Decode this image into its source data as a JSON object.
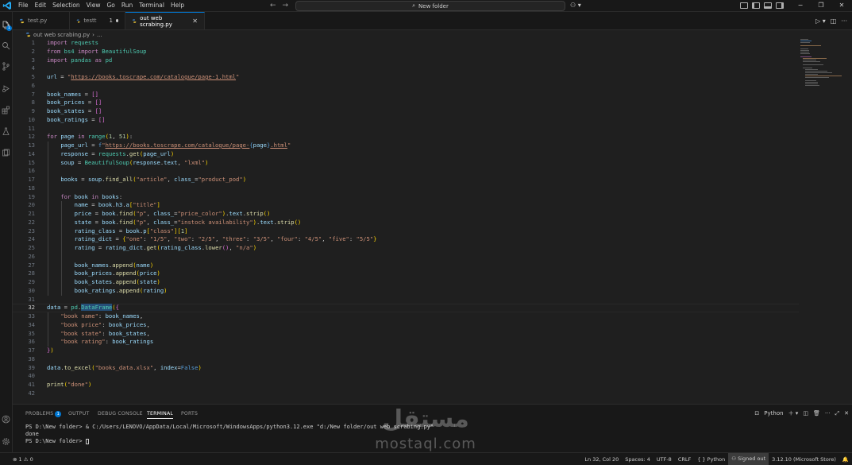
{
  "menu": [
    "File",
    "Edit",
    "Selection",
    "View",
    "Go",
    "Run",
    "Terminal",
    "Help"
  ],
  "search": {
    "label": "New folder"
  },
  "window_controls": {
    "minimize": "−",
    "restore": "❐",
    "close": "✕"
  },
  "tabs": [
    {
      "label": "test.py",
      "modified": "",
      "active": false
    },
    {
      "label": "testt",
      "modified": "1",
      "active": false
    },
    {
      "label": "out web scrabing.py",
      "modified": "",
      "active": true
    }
  ],
  "breadcrumb": {
    "file": "out web scrabing.py",
    "rest": "..."
  },
  "code_lines": [
    {
      "n": "1",
      "html": "<span class=\"k\">import</span> <span class=\"t\">requests</span>"
    },
    {
      "n": "2",
      "html": "<span class=\"k\">from</span> <span class=\"t\">bs4</span> <span class=\"k\">import</span> <span class=\"t\">BeautifulSoup</span>"
    },
    {
      "n": "3",
      "html": "<span class=\"k\">import</span> <span class=\"t\">pandas</span> <span class=\"k\">as</span> <span class=\"t\">pd</span>"
    },
    {
      "n": "4",
      "html": ""
    },
    {
      "n": "5",
      "html": "<span class=\"v\">url</span> = <span class=\"s\">\"<span class=\"u\">https://books.toscrape.com/catalogue/page-1.html</span>\"</span>"
    },
    {
      "n": "6",
      "html": ""
    },
    {
      "n": "7",
      "html": "<span class=\"v\">book_names</span> = <span class=\"p2\">[]</span>"
    },
    {
      "n": "8",
      "html": "<span class=\"v\">book_prices</span> = <span class=\"p2\">[]</span>"
    },
    {
      "n": "9",
      "html": "<span class=\"v\">book_states</span> = <span class=\"p2\">[]</span>"
    },
    {
      "n": "10",
      "html": "<span class=\"v\">book_ratings</span> = <span class=\"p2\">[]</span>"
    },
    {
      "n": "11",
      "html": ""
    },
    {
      "n": "12",
      "html": "<span class=\"k\">for</span> <span class=\"v\">page</span> <span class=\"k\">in</span> <span class=\"t\">range</span><span class=\"p\">(</span><span class=\"n\">1</span>, <span class=\"n\">51</span><span class=\"p\">)</span>:"
    },
    {
      "n": "13",
      "html": "    <span class=\"v\">page_url</span> = <span class=\"b\">f</span><span class=\"s\">\"<span class=\"u\">https://books.toscrape.com/catalogue/page-</span></span><span class=\"b\">{</span><span class=\"v\">page</span><span class=\"b\">}</span><span class=\"s\"><span class=\"u\">.html</span>\"</span>"
    },
    {
      "n": "14",
      "html": "    <span class=\"v\">response</span> = <span class=\"t\">requests</span>.<span class=\"f\">get</span><span class=\"p\">(</span><span class=\"v\">page_url</span><span class=\"p\">)</span>"
    },
    {
      "n": "15",
      "html": "    <span class=\"v\">soup</span> = <span class=\"t\">BeautifulSoup</span><span class=\"p\">(</span><span class=\"v\">response</span>.<span class=\"v\">text</span>, <span class=\"s\">\"lxml\"</span><span class=\"p\">)</span>"
    },
    {
      "n": "16",
      "html": ""
    },
    {
      "n": "17",
      "html": "    <span class=\"v\">books</span> = <span class=\"v\">soup</span>.<span class=\"f\">find_all</span><span class=\"p\">(</span><span class=\"s\">\"article\"</span>, <span class=\"v\">class_</span>=<span class=\"s\">\"product_pod\"</span><span class=\"p\">)</span>"
    },
    {
      "n": "18",
      "html": ""
    },
    {
      "n": "19",
      "html": "    <span class=\"k\">for</span> <span class=\"v\">book</span> <span class=\"k\">in</span> <span class=\"v\">books</span>:"
    },
    {
      "n": "20",
      "html": "        <span class=\"v\">name</span> = <span class=\"v\">book</span>.<span class=\"v\">h3</span>.<span class=\"v\">a</span><span class=\"p\">[</span><span class=\"s\">\"title\"</span><span class=\"p\">]</span>"
    },
    {
      "n": "21",
      "html": "        <span class=\"v\">price</span> = <span class=\"v\">book</span>.<span class=\"f\">find</span><span class=\"p\">(</span><span class=\"s\">\"p\"</span>, <span class=\"v\">class_</span>=<span class=\"s\">\"price_color\"</span><span class=\"p\">)</span>.<span class=\"v\">text</span>.<span class=\"f\">strip</span><span class=\"p\">()</span>"
    },
    {
      "n": "22",
      "html": "        <span class=\"v\">state</span> = <span class=\"v\">book</span>.<span class=\"f\">find</span><span class=\"p\">(</span><span class=\"s\">\"p\"</span>, <span class=\"v\">class_</span>=<span class=\"s\">\"instock availability\"</span><span class=\"p\">)</span>.<span class=\"v\">text</span>.<span class=\"f\">strip</span><span class=\"p\">()</span>"
    },
    {
      "n": "23",
      "html": "        <span class=\"v\">rating_class</span> = <span class=\"v\">book</span>.<span class=\"v\">p</span><span class=\"p\">[</span><span class=\"s\">\"class\"</span><span class=\"p\">]</span><span class=\"p\">[</span><span class=\"n\">1</span><span class=\"p\">]</span>"
    },
    {
      "n": "24",
      "html": "        <span class=\"v\">rating_dict</span> = <span class=\"p\">{</span><span class=\"s\">\"one\"</span>: <span class=\"s\">\"1/5\"</span>, <span class=\"s\">\"two\"</span>: <span class=\"s\">\"2/5\"</span>, <span class=\"s\">\"three\"</span>: <span class=\"s\">\"3/5\"</span>, <span class=\"s\">\"four\"</span>: <span class=\"s\">\"4/5\"</span>, <span class=\"s\">\"five\"</span>: <span class=\"s\">\"5/5\"</span><span class=\"p\">}</span>"
    },
    {
      "n": "25",
      "html": "        <span class=\"v\">rating</span> = <span class=\"v\">rating_dict</span>.<span class=\"f\">get</span><span class=\"p\">(</span><span class=\"v\">rating_class</span>.<span class=\"f\">lower</span><span class=\"p2\">()</span>, <span class=\"s\">\"n/a\"</span><span class=\"p\">)</span>"
    },
    {
      "n": "26",
      "html": ""
    },
    {
      "n": "27",
      "html": "        <span class=\"v\">book_names</span>.<span class=\"f\">append</span><span class=\"p\">(</span><span class=\"v\">name</span><span class=\"p\">)</span>"
    },
    {
      "n": "28",
      "html": "        <span class=\"v\">book_prices</span>.<span class=\"f\">append</span><span class=\"p\">(</span><span class=\"v\">price</span><span class=\"p\">)</span>"
    },
    {
      "n": "29",
      "html": "        <span class=\"v\">book_states</span>.<span class=\"f\">append</span><span class=\"p\">(</span><span class=\"v\">state</span><span class=\"p\">)</span>"
    },
    {
      "n": "30",
      "html": "        <span class=\"v\">book_ratings</span>.<span class=\"f\">append</span><span class=\"p\">(</span><span class=\"v\">rating</span><span class=\"p\">)</span>"
    },
    {
      "n": "31",
      "html": ""
    },
    {
      "n": "32",
      "html": "<span class=\"v\">data</span> = <span class=\"t\">pd</span>.<span class=\"t hl\">DataFrame</span><span class=\"p\">(</span><span class=\"p2\">{</span>"
    },
    {
      "n": "33",
      "html": "    <span class=\"s\">\"book name\"</span>: <span class=\"v\">book_names</span>,"
    },
    {
      "n": "34",
      "html": "    <span class=\"s\">\"book price\"</span>: <span class=\"v\">book_prices</span>,"
    },
    {
      "n": "35",
      "html": "    <span class=\"s\">\"book state\"</span>: <span class=\"v\">book_states</span>,"
    },
    {
      "n": "36",
      "html": "    <span class=\"s\">\"book rating\"</span>: <span class=\"v\">book_ratings</span>"
    },
    {
      "n": "37",
      "html": "<span class=\"p2\">}</span><span class=\"p\">)</span>"
    },
    {
      "n": "38",
      "html": ""
    },
    {
      "n": "39",
      "html": "<span class=\"v\">data</span>.<span class=\"f\">to_excel</span><span class=\"p\">(</span><span class=\"s\">\"books_data.xlsx\"</span>, <span class=\"v\">index</span>=<span class=\"b\">False</span><span class=\"p\">)</span>"
    },
    {
      "n": "40",
      "html": ""
    },
    {
      "n": "41",
      "html": "<span class=\"f\">print</span><span class=\"p\">(</span><span class=\"s\">\"done\"</span><span class=\"p\">)</span>"
    },
    {
      "n": "42",
      "html": ""
    }
  ],
  "current_line": "32",
  "panel": {
    "tabs": [
      {
        "label": "PROBLEMS",
        "badge": "1",
        "active": false
      },
      {
        "label": "OUTPUT",
        "badge": "",
        "active": false
      },
      {
        "label": "DEBUG CONSOLE",
        "badge": "",
        "active": false
      },
      {
        "label": "TERMINAL",
        "badge": "",
        "active": true
      },
      {
        "label": "PORTS",
        "badge": "",
        "active": false
      }
    ],
    "terminal_kind": "Python",
    "terminal_lines": [
      "PS D:\\New folder> & C:/Users/LENOVO/AppData/Local/Microsoft/WindowsApps/python3.12.exe \"d:/New folder/out web scrabing.py\"",
      "done",
      "PS D:\\New folder> "
    ]
  },
  "status": {
    "errors": "1",
    "warnings": "0",
    "position": "Ln 32, Col 20",
    "spaces": "Spaces: 4",
    "encoding": "UTF-8",
    "eol": "CRLF",
    "language": "Python",
    "account": "Signed out",
    "interpreter": "3.12.10 (Microsoft Store)"
  },
  "watermark": {
    "arabic": "مستقل",
    "latin": "mostaql.com"
  },
  "colors": {
    "accent": "#0078d4",
    "editor_bg": "#1f1f1f",
    "chrome_bg": "#181818"
  }
}
